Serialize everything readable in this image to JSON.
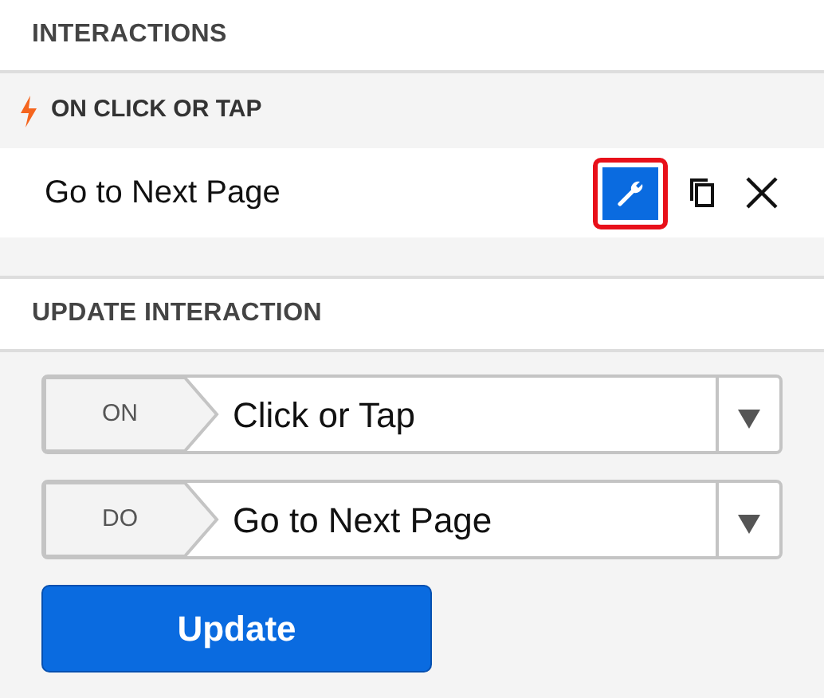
{
  "interactions": {
    "title": "INTERACTIONS",
    "trigger": {
      "label": "ON CLICK OR TAP"
    },
    "items": [
      {
        "label": "Go to Next Page",
        "edit_highlighted": true
      }
    ]
  },
  "update": {
    "title": "UPDATE INTERACTION",
    "fields": [
      {
        "tag": "ON",
        "value": "Click or Tap"
      },
      {
        "tag": "DO",
        "value": "Go to Next Page"
      }
    ],
    "button": "Update"
  }
}
